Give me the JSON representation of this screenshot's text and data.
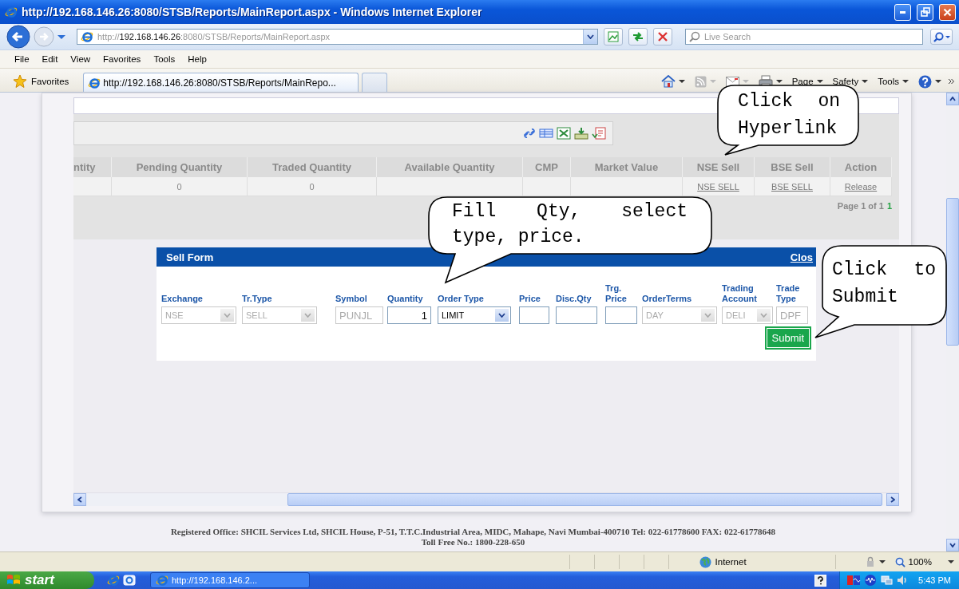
{
  "window": {
    "title": "http://192.168.146.26:8080/STSB/Reports/MainReport.aspx - Windows Internet Explorer"
  },
  "address_bar": {
    "scheme": "http://",
    "host": "192.168.146.26",
    "path": ":8080/STSB/Reports/MainReport.aspx"
  },
  "search": {
    "placeholder": "Live Search"
  },
  "menu": [
    "File",
    "Edit",
    "View",
    "Favorites",
    "Tools",
    "Help"
  ],
  "favorites_bar": {
    "label": "Favorites"
  },
  "tabs": [
    {
      "label": "http://192.168.146.26:8080/STSB/Reports/MainRepo...",
      "selected": true
    },
    {
      "selected": false
    }
  ],
  "command_bar": [
    "Page",
    "Safety",
    "Tools"
  ],
  "report": {
    "columns": [
      {
        "header": "ntity"
      },
      {
        "header": "Pending Quantity",
        "cell": {
          "kind": "text",
          "text": "0"
        }
      },
      {
        "header": "Traded Quantity",
        "cell": {
          "kind": "text",
          "text": "0"
        }
      },
      {
        "header": "Available Quantity"
      },
      {
        "header": "CMP"
      },
      {
        "header": "Market Value"
      },
      {
        "header": "NSE Sell",
        "cell": {
          "kind": "link",
          "text": "NSE SELL"
        }
      },
      {
        "header": "BSE Sell",
        "cell": {
          "kind": "link",
          "text": "BSE SELL"
        }
      },
      {
        "header": "Action",
        "cell": {
          "kind": "link",
          "text": "Release"
        }
      }
    ],
    "pager": {
      "label": "Page 1 of 1",
      "pages": [
        {
          "label": "1",
          "selected": true
        }
      ]
    }
  },
  "sell_form": {
    "title": "Sell Form",
    "close": "Clos",
    "fields": [
      {
        "label": "Exchange",
        "kind": "select",
        "value": "NSE",
        "disabled": true
      },
      {
        "label": "Tr.Type",
        "kind": "select",
        "value": "SELL",
        "disabled": true
      },
      {
        "label": "Symbol",
        "kind": "text",
        "value": "PUNJL",
        "disabled": true
      },
      {
        "label": "Quantity",
        "kind": "number",
        "value": "1",
        "disabled": false
      },
      {
        "label": "Order Type",
        "kind": "select",
        "value": "LIMIT",
        "disabled": false
      },
      {
        "label": "Price",
        "kind": "text",
        "disabled": false
      },
      {
        "label": "Disc.Qty",
        "kind": "text",
        "disabled": false
      },
      {
        "label": "Trg. Price",
        "kind": "text",
        "disabled": false
      },
      {
        "label": "OrderTerms",
        "kind": "select",
        "value": "DAY",
        "disabled": true
      },
      {
        "label": "Trading Account",
        "kind": "select",
        "value": "DELI",
        "disabled": true
      },
      {
        "label": "Trade Type",
        "kind": "text",
        "value": "DPF",
        "disabled": true
      }
    ],
    "submit": "Submit"
  },
  "callouts": [
    {
      "text": "Click on Hyperlink"
    },
    {
      "text": "Fill Qty, select type, price."
    },
    {
      "text": "Click to Submit"
    }
  ],
  "footer": [
    "Registered Office: SHCIL Services Ltd, SHCIL House, P-51, T.T.C.Industrial Area, MIDC, Mahape, Navi Mumbai-400710 Tel: 022-61778600 FAX: 022-61778648",
    "Toll Free No.: 1800-228-650"
  ],
  "status_bar": {
    "zone": "Internet",
    "zoom": "100%"
  },
  "taskbar": {
    "start": "start",
    "tasks": [
      {
        "label": "http://192.168.146.2...",
        "selected": false
      }
    ],
    "clock": "5:43 PM"
  }
}
